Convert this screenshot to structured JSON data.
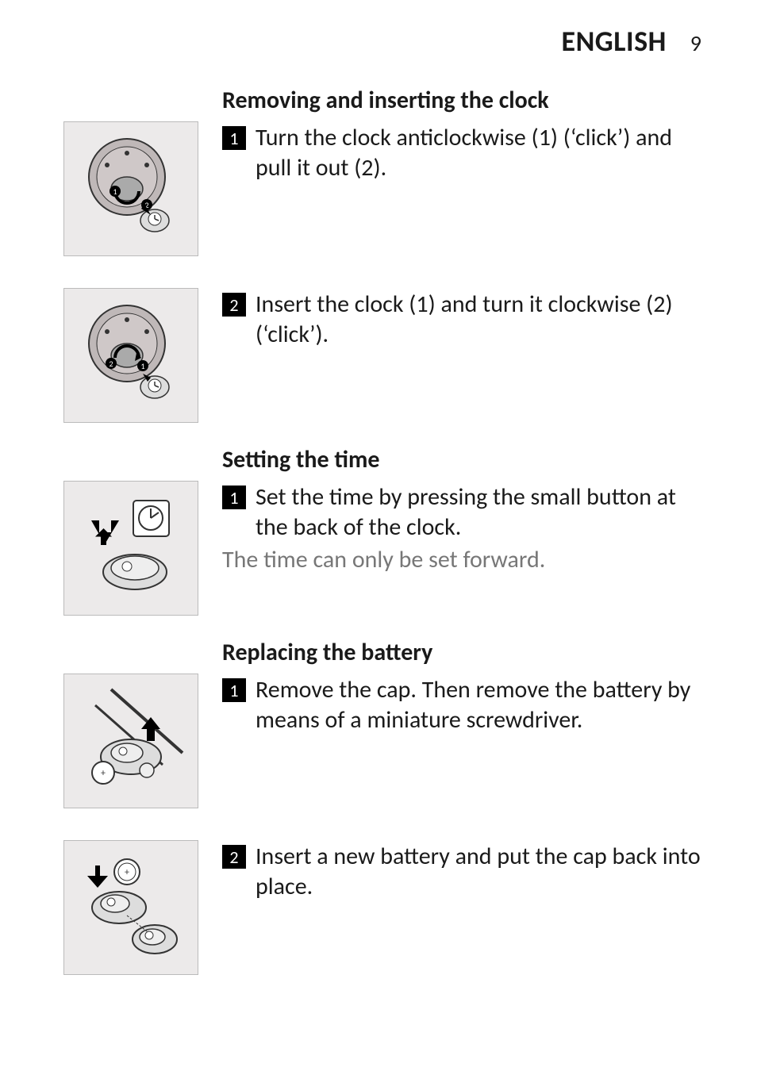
{
  "header": {
    "language": "ENGLISH",
    "page_number": "9"
  },
  "sections": {
    "removing": {
      "title": "Removing and inserting the clock",
      "steps": {
        "s1": {
          "num": "1",
          "text": "Turn the clock anticlockwise (1) (‘click’) and pull it out (2)."
        },
        "s2": {
          "num": "2",
          "text": "Insert the clock (1) and turn it clockwise (2) (‘click’)."
        }
      }
    },
    "setting": {
      "title": "Setting the time",
      "steps": {
        "s1": {
          "num": "1",
          "text": "Set the time by pressing the small button at the back of the clock."
        }
      },
      "note": "The time can only be set forward."
    },
    "replacing": {
      "title": "Replacing the battery",
      "steps": {
        "s1": {
          "num": "1",
          "text": "Remove the cap. Then remove the battery by means of a miniature screwdriver."
        },
        "s2": {
          "num": "2",
          "text": "Insert a new battery and put the cap back into place."
        }
      }
    }
  }
}
